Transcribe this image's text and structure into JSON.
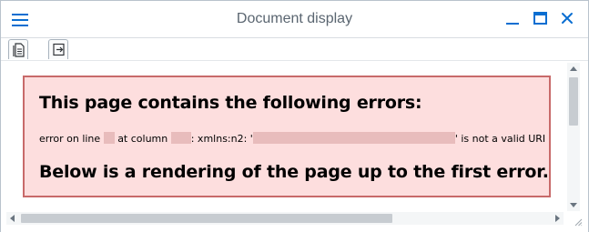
{
  "window": {
    "title": "Document display",
    "colors": {
      "accent": "#0a6ed1",
      "error_bg": "#fddede",
      "error_border": "#c86a6a"
    }
  },
  "toolbar": {
    "buttons": [
      {
        "icon": "document-icon"
      },
      {
        "icon": "export-icon"
      }
    ]
  },
  "error": {
    "heading": "This page contains the following errors:",
    "line_prefix": "error on line",
    "line_at_column": "at column",
    "line_namespace": ": xmlns:n2: '",
    "line_suffix": "' is not a valid URI",
    "footer_heading": "Below is a rendering of the page up to the first error."
  }
}
